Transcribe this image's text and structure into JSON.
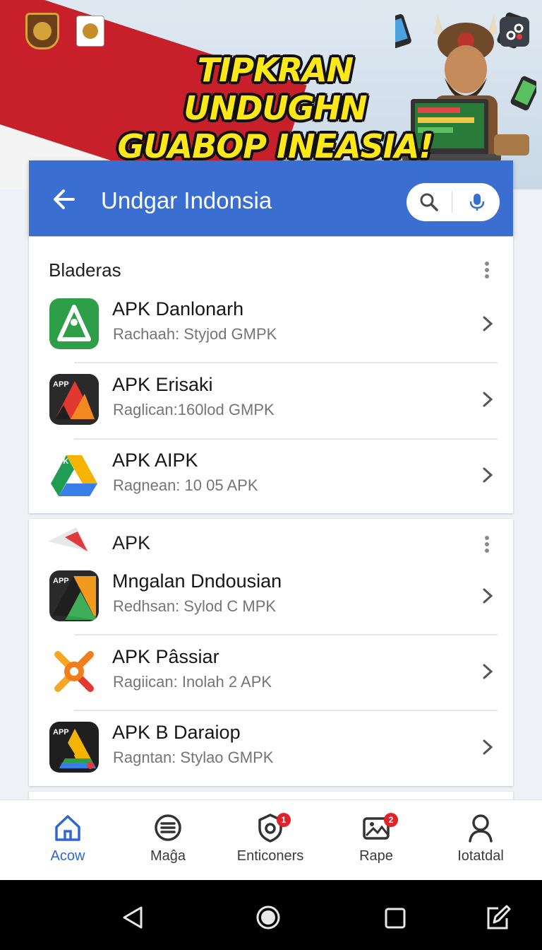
{
  "banner": {
    "title_line1": "TIPKRAN UNDUGHN",
    "title_line2": "GUABOP INEASIA!",
    "emblem_left": "garuda-emblem",
    "emblem_right": "garuda-emblem-small"
  },
  "header": {
    "title": "Undgar Indonsia",
    "back_icon": "arrow-left-icon",
    "search_icon": "search-icon",
    "mic_icon": "microphone-icon"
  },
  "sections": [
    {
      "title": "Bladeras",
      "items": [
        {
          "title": "APK Danlonarh",
          "subtitle": "Rachaah: Styjod GMPK",
          "icon_color": "#2f9e48"
        },
        {
          "title": "APK Erisaki",
          "subtitle": "Raglican:160lod GMPK",
          "icon_color": "#e2392f"
        },
        {
          "title": "APK AIPK",
          "subtitle": "Ragnean: 10 05 APK",
          "icon_color": "#f5b400"
        }
      ]
    },
    {
      "title": "APK",
      "items": [
        {
          "title": "Mngalan Dndousian",
          "subtitle": "Redhsan: Sylod C MPK",
          "icon_color": "#f29a1d"
        },
        {
          "title": "APK Pâssiar",
          "subtitle": "Ragiican: Inolah 2 APK",
          "icon_color": "#f07e1f"
        },
        {
          "title": "APK B Daraiop",
          "subtitle": "Ragntan: Stylao GMPK",
          "icon_color": "#f5b400"
        }
      ]
    }
  ],
  "bottom_nav": [
    {
      "label": "Acow",
      "icon": "home-icon",
      "active": true
    },
    {
      "label": "Maĝa",
      "icon": "list-circle-icon",
      "active": false
    },
    {
      "label": "Enticoners",
      "icon": "shield-icon",
      "active": false,
      "badge": "1"
    },
    {
      "label": "Rape",
      "icon": "image-icon",
      "active": false,
      "badge": "2"
    },
    {
      "label": "Iotatdal",
      "icon": "person-icon",
      "active": false
    }
  ],
  "colors": {
    "header_blue": "#3a6fd1",
    "nav_active": "#2e67d4",
    "banner_yellow": "#ffe81a",
    "flag_red": "#c8202a"
  }
}
